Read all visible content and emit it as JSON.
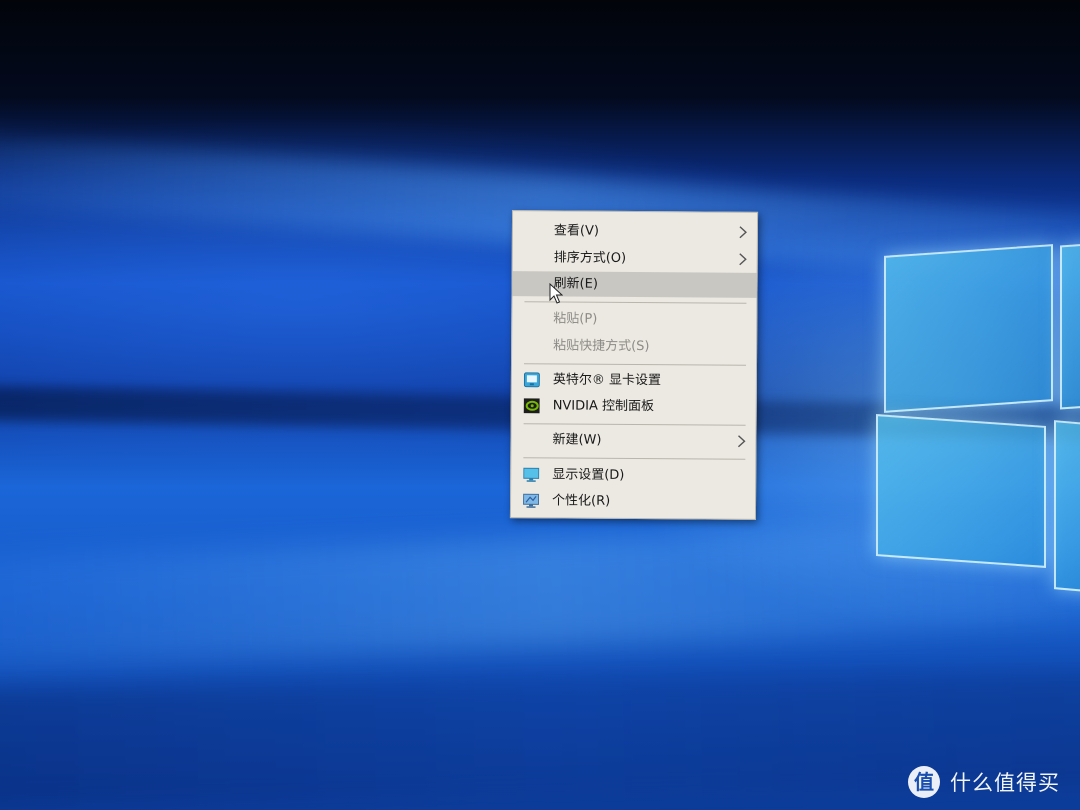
{
  "context_menu": {
    "items": [
      {
        "label": "查看(V)",
        "submenu": true,
        "enabled": true,
        "icon": ""
      },
      {
        "label": "排序方式(O)",
        "submenu": true,
        "enabled": true,
        "icon": ""
      },
      {
        "label": "刷新(E)",
        "submenu": false,
        "enabled": true,
        "icon": "",
        "highlighted": true
      },
      {
        "label": "粘贴(P)",
        "submenu": false,
        "enabled": false,
        "icon": ""
      },
      {
        "label": "粘贴快捷方式(S)",
        "submenu": false,
        "enabled": false,
        "icon": ""
      },
      {
        "label": "英特尔® 显卡设置",
        "submenu": false,
        "enabled": true,
        "icon": "intel-graphics-icon"
      },
      {
        "label": "NVIDIA 控制面板",
        "submenu": false,
        "enabled": true,
        "icon": "nvidia-icon"
      },
      {
        "label": "新建(W)",
        "submenu": true,
        "enabled": true,
        "icon": ""
      },
      {
        "label": "显示设置(D)",
        "submenu": false,
        "enabled": true,
        "icon": "display-settings-icon"
      },
      {
        "label": "个性化(R)",
        "submenu": false,
        "enabled": true,
        "icon": "personalize-icon"
      }
    ],
    "colors": {
      "background": "#ece9e2",
      "highlight": "#c9c7c2",
      "disabled_text": "#8d8b86"
    }
  },
  "watermark": {
    "logo_glyph": "值",
    "text": "什么值得买"
  },
  "desktop": {
    "wallpaper": "windows-10-hero",
    "accent": "#1450c8"
  }
}
